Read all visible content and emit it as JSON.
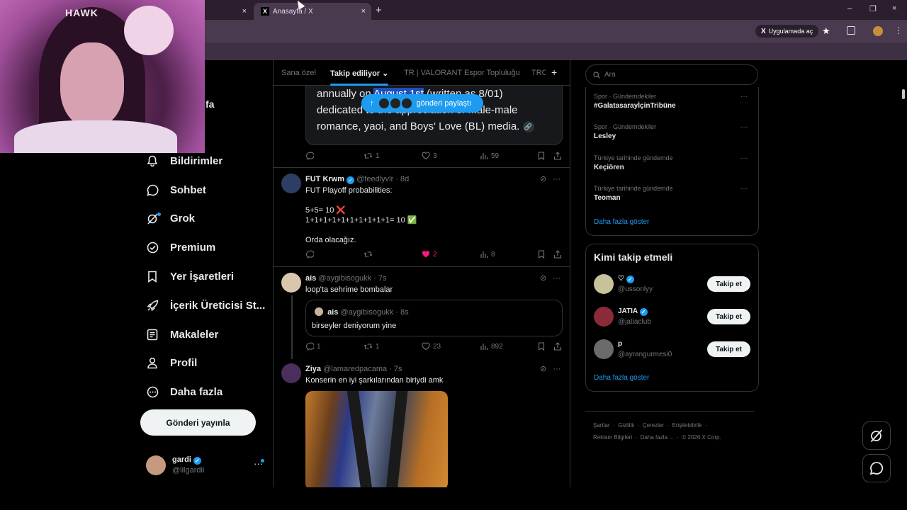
{
  "browser": {
    "tabs": [
      {
        "label": "",
        "close": "×"
      },
      {
        "label": "Anasayfa / X",
        "favicon": "X",
        "close": "×"
      }
    ],
    "new_tab": "+",
    "window_controls": [
      "–",
      "❐",
      "×"
    ],
    "open_app_label": "Uygulamada aç",
    "open_app_icon": "X"
  },
  "webcam": {
    "overlay_text": "HAWK"
  },
  "nav": {
    "partial_label": "fa",
    "items": [
      {
        "label": "Bildirimler",
        "icon": "bell-icon"
      },
      {
        "label": "Sohbet",
        "icon": "chat-bubble-icon"
      },
      {
        "label": "Grok",
        "icon": "grok-icon"
      },
      {
        "label": "Premium",
        "icon": "verified-badge-icon"
      },
      {
        "label": "Yer İşaretleri",
        "icon": "bookmark-icon"
      },
      {
        "label": "İçerik Üreticisi St...",
        "icon": "rocket-icon"
      },
      {
        "label": "Makaleler",
        "icon": "article-icon"
      },
      {
        "label": "Profil",
        "icon": "person-icon"
      },
      {
        "label": "Daha fazla",
        "icon": "more-circle-icon"
      }
    ],
    "post_button": "Gönderi yayınla",
    "account": {
      "name": "gardi",
      "handle": "@lilgardii",
      "more": "···"
    }
  },
  "feed": {
    "tabs": [
      "Sana özel",
      "Takip ediliyor",
      "TR | VALORANT Espor Topluluğu",
      "TRC"
    ],
    "active_tab": "Takip ediliyor",
    "add_tab": "+",
    "new_posts_pill": "gönderi paylaştı",
    "quoted_card": {
      "line1_pre": "annually on ",
      "line1_highlight": "August 1st",
      "line1_post": " (written as 8/01)",
      "line2": "dedicated to the appreciation of male-male",
      "line3": "romance, yaoi, and Boys' Love (BL) media."
    },
    "posts": [
      {
        "actions": {
          "reply": "",
          "repost": "1",
          "like": "3",
          "views": "59"
        }
      },
      {
        "name": "FUT Krwm",
        "handle": "@feedlyvlr",
        "time": "· 8d",
        "verified": true,
        "text": "FUT Playoff probabilities:\n\n5+5= 10 ❌\n1+1+1+1+1+1+1+1+1+1= 10 ✅\n\nOrda olacağız.",
        "actions": {
          "reply": "",
          "repost": "",
          "like": "2",
          "liked": true,
          "views": "8"
        }
      },
      {
        "name": "ais",
        "handle": "@aygibisogukk",
        "time": "· 7s",
        "text": "loop'ta sehrime bombalar",
        "quote": {
          "name": "ais",
          "handle": "@aygibisogukk",
          "time": "· 8s",
          "text": "birseyler deniyorum yine"
        },
        "actions": {
          "reply": "1",
          "repost": "1",
          "like": "23",
          "views": "892"
        }
      },
      {
        "name": "Ziya",
        "handle": "@lamaredpacama",
        "time": "· 7s",
        "text": "Konserin en iyi şarkılarından biriydi amk"
      }
    ]
  },
  "sidebar": {
    "search_placeholder": "Ara",
    "trends": [
      {
        "meta": "Spor · Gündemdekiler",
        "name": "#GalatasarayİçinTribüne"
      },
      {
        "meta": "Spor · Gündemdekiler",
        "name": "Lesley"
      },
      {
        "meta": "Türkiye tarihinde gündemde",
        "name": "Keçiören"
      },
      {
        "meta": "Türkiye tarihinde gündemde",
        "name": "Teoman"
      }
    ],
    "trends_show_more": "Daha fazla göster",
    "who_to_follow": {
      "title": "Kimi takip etmeli",
      "accounts": [
        {
          "name": "♡",
          "handle": "@ussonlyy",
          "verified": true,
          "button": "Takip et"
        },
        {
          "name": "JATIA",
          "handle": "@jatiaclub",
          "verified": true,
          "button": "Takip et"
        },
        {
          "name": "p",
          "handle": "@ayrangurmesi0",
          "verified": false,
          "button": "Takip et"
        }
      ],
      "show_more": "Daha fazla göster"
    },
    "footer": {
      "line1": [
        "Şartlar",
        "Gizlilik",
        "Çerezler",
        "Erişilebilirlik"
      ],
      "line2": [
        "Reklam Bilgileri",
        "Daha fazla ...",
        "© 2026 X Corp."
      ]
    }
  },
  "colors": {
    "accent": "#1d9bf0",
    "like": "#f91880",
    "background": "#000000",
    "text": "#e7e9ea",
    "muted": "#71767b"
  }
}
